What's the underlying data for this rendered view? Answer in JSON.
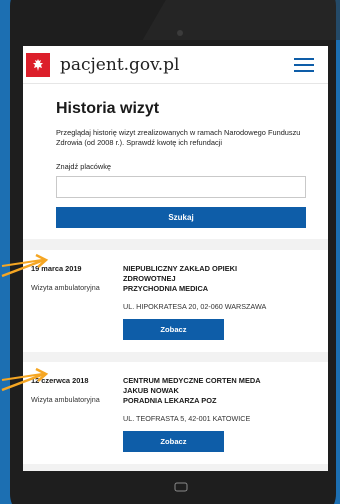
{
  "header": {
    "site_name": "pacjent.gov.pl",
    "logo_icon": "eagle-icon",
    "menu_icon": "hamburger-menu-icon"
  },
  "page": {
    "title": "Historia wizyt",
    "subtitle": "Przeglądaj historię wizyt zrealizowanych w ramach Narodowego Funduszu Zdrowia (od 2008 r.). Sprawdź kwotę ich refundacji",
    "search_label": "Znajdź placówkę",
    "search_value": "",
    "search_button": "Szukaj"
  },
  "visits": [
    {
      "date": "19 marca 2019",
      "type": "Wizyta ambulatoryjna",
      "institution_lines": [
        "NIEPUBLICZNY ZAKŁAD OPIEKI",
        "ZDROWOTNEJ",
        "PRZYCHODNIA MEDICA"
      ],
      "address": "UL. HIPOKRATESA 20, 02-060 WARSZAWA",
      "button": "Zobacz"
    },
    {
      "date": "12 czerwca 2018",
      "type": "Wizyta ambulatoryjna",
      "institution_lines": [
        "CENTRUM MEDYCZNE CORTEN MEDA",
        "JAKUB NOWAK",
        "PORADNIA LEKARZA POZ"
      ],
      "address": "UL. TEOFRASTA 5, 42-001 KATOWICE",
      "button": "Zobacz"
    }
  ],
  "colors": {
    "background": "#1c6fb2",
    "accent": "#0e5da8",
    "logo_red": "#dc1f2b",
    "arrow": "#f5a623"
  }
}
